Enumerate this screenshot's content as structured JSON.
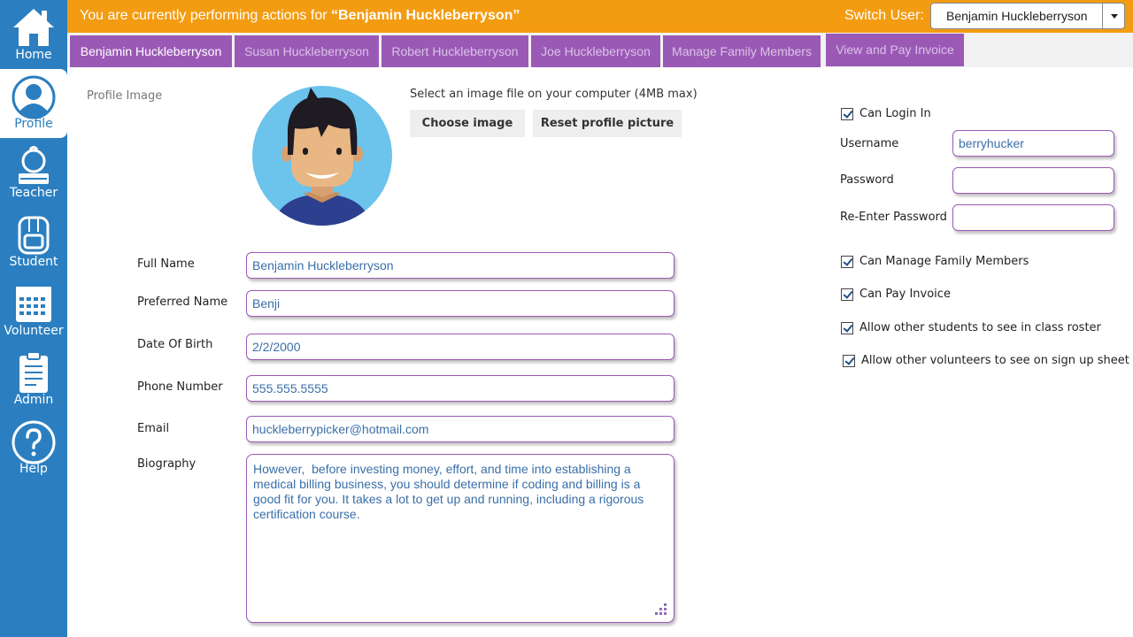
{
  "sidebar": {
    "items": [
      {
        "label": "Home",
        "icon": "home-icon"
      },
      {
        "label": "Profile",
        "icon": "user-icon",
        "active": true
      },
      {
        "label": "Teacher",
        "icon": "teacher-icon"
      },
      {
        "label": "Student",
        "icon": "backpack-icon"
      },
      {
        "label": "Volunteer",
        "icon": "calendar-icon"
      },
      {
        "label": "Admin",
        "icon": "clipboard-icon"
      },
      {
        "label": "Help",
        "icon": "question-icon"
      }
    ]
  },
  "banner": {
    "prefix": "You are currently  performing actions for ",
    "user": "“Benjamin  Huckleberryson”",
    "switch_label": "Switch User:",
    "switch_value": "Benjamin Huckleberryson"
  },
  "tabs": [
    {
      "label": "Benjamin Huckleberryson",
      "active": true
    },
    {
      "label": "Susan Huckleberryson"
    },
    {
      "label": "Robert Huckleberryson"
    },
    {
      "label": "Joe Huckleberryson"
    },
    {
      "label": "Manage Family Members"
    },
    {
      "label": "View and Pay Invoice"
    }
  ],
  "profile": {
    "image_label": "Profile Image",
    "hint": "Select an image file on your computer (4MB max)",
    "choose_label": "Choose image",
    "reset_label": "Reset profile picture"
  },
  "form": {
    "full_name": {
      "label": "Full Name",
      "value": "Benjamin Huckleberryson"
    },
    "preferred_name": {
      "label": "Preferred Name",
      "value": "Benji"
    },
    "dob": {
      "label": "Date Of Birth",
      "value": "2/2/2000"
    },
    "phone": {
      "label": "Phone Number",
      "value": "555.555.5555"
    },
    "email": {
      "label": "Email",
      "value": "huckleberrypicker@hotmail.com"
    },
    "bio": {
      "label": "Biography",
      "value": "However,  before investing money, effort, and time into establishing a medical billing business, you should determine if coding and billing is a good fit for you. It takes a lot to get up and running, including a rigorous certification course."
    }
  },
  "account": {
    "can_login": {
      "label": "Can Login In",
      "checked": true
    },
    "username": {
      "label": "Username",
      "value": "berryhucker"
    },
    "password": {
      "label": "Password",
      "value": ""
    },
    "reenter": {
      "label": "Re-Enter Password",
      "value": ""
    },
    "manage_family": {
      "label": "Can Manage Family Members",
      "checked": true
    },
    "pay_invoice": {
      "label": "Can Pay Invoice",
      "checked": true
    },
    "class_roster": {
      "label": "Allow other students to see in class roster",
      "checked": true
    },
    "signup_sheet": {
      "label": "Allow other volunteers to see on sign up sheet",
      "checked": true
    }
  },
  "colors": {
    "sidebar": "#2b7fc0",
    "banner": "#f39c12",
    "tab": "#9b59b6",
    "input_text": "#3a6fa8"
  }
}
